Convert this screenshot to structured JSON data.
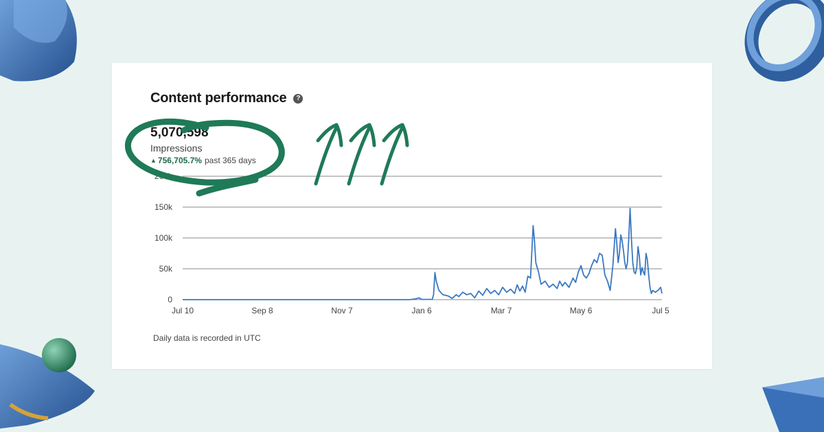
{
  "card": {
    "title": "Content performance",
    "help_icon": "?",
    "metric_value": "5,070,598",
    "metric_label": "Impressions",
    "change_value": "756,705.7%",
    "change_period": "past 365 days",
    "footnote": "Daily data is recorded in UTC"
  },
  "colors": {
    "line": "#3a78c2",
    "annotation": "#1f7a58",
    "change": "#1f6b4a",
    "background": "#e8f3f1"
  },
  "chart_data": {
    "type": "line",
    "y_tick_labels": [
      "0",
      "50k",
      "100k",
      "150k",
      "200k"
    ],
    "y_ticks": [
      0,
      50000,
      100000,
      150000,
      200000
    ],
    "ylim": [
      0,
      200000
    ],
    "x_tick_labels": [
      "Jul 10",
      "Sep 8",
      "Nov 7",
      "Jan 6",
      "Mar 7",
      "May 6",
      "Jul 5"
    ],
    "x_tick_days": [
      0,
      60,
      120,
      180,
      240,
      300,
      360
    ],
    "xlim": [
      0,
      361
    ],
    "grid": true,
    "series": [
      {
        "points": [
          [
            0,
            0
          ],
          [
            120,
            0
          ],
          [
            160,
            0
          ],
          [
            171,
            0
          ],
          [
            176,
            1500
          ],
          [
            178,
            3000
          ],
          [
            180,
            500
          ],
          [
            188,
            500
          ],
          [
            189,
            8000
          ],
          [
            190,
            44000
          ],
          [
            191,
            30000
          ],
          [
            193,
            15000
          ],
          [
            196,
            8000
          ],
          [
            200,
            6000
          ],
          [
            203,
            2000
          ],
          [
            206,
            8000
          ],
          [
            208,
            5000
          ],
          [
            211,
            12000
          ],
          [
            214,
            8000
          ],
          [
            217,
            10000
          ],
          [
            220,
            3000
          ],
          [
            223,
            14000
          ],
          [
            226,
            7000
          ],
          [
            229,
            18000
          ],
          [
            232,
            10000
          ],
          [
            235,
            15000
          ],
          [
            238,
            8000
          ],
          [
            241,
            20000
          ],
          [
            244,
            12000
          ],
          [
            247,
            17000
          ],
          [
            250,
            10000
          ],
          [
            252,
            24000
          ],
          [
            254,
            14000
          ],
          [
            256,
            22000
          ],
          [
            258,
            12000
          ],
          [
            260,
            38000
          ],
          [
            262,
            35000
          ],
          [
            264,
            120000
          ],
          [
            265,
            95000
          ],
          [
            266,
            60000
          ],
          [
            268,
            45000
          ],
          [
            270,
            25000
          ],
          [
            273,
            30000
          ],
          [
            276,
            20000
          ],
          [
            279,
            25000
          ],
          [
            282,
            18000
          ],
          [
            284,
            30000
          ],
          [
            286,
            22000
          ],
          [
            288,
            28000
          ],
          [
            291,
            20000
          ],
          [
            294,
            35000
          ],
          [
            296,
            28000
          ],
          [
            298,
            45000
          ],
          [
            300,
            55000
          ],
          [
            302,
            40000
          ],
          [
            304,
            35000
          ],
          [
            306,
            42000
          ],
          [
            308,
            55000
          ],
          [
            310,
            65000
          ],
          [
            312,
            60000
          ],
          [
            314,
            75000
          ],
          [
            316,
            72000
          ],
          [
            318,
            40000
          ],
          [
            320,
            30000
          ],
          [
            322,
            15000
          ],
          [
            324,
            55000
          ],
          [
            325,
            85000
          ],
          [
            326,
            115000
          ],
          [
            327,
            90000
          ],
          [
            328,
            60000
          ],
          [
            329,
            75000
          ],
          [
            330,
            105000
          ],
          [
            331,
            95000
          ],
          [
            332,
            80000
          ],
          [
            333,
            60000
          ],
          [
            334,
            50000
          ],
          [
            335,
            60000
          ],
          [
            336,
            100000
          ],
          [
            337,
            148000
          ],
          [
            338,
            100000
          ],
          [
            339,
            60000
          ],
          [
            340,
            45000
          ],
          [
            341,
            42000
          ],
          [
            342,
            52000
          ],
          [
            343,
            86000
          ],
          [
            344,
            70000
          ],
          [
            345,
            40000
          ],
          [
            346,
            52000
          ],
          [
            347,
            45000
          ],
          [
            348,
            40000
          ],
          [
            349,
            75000
          ],
          [
            350,
            65000
          ],
          [
            351,
            40000
          ],
          [
            352,
            20000
          ],
          [
            353,
            10000
          ],
          [
            354,
            15000
          ],
          [
            356,
            12000
          ],
          [
            358,
            15000
          ],
          [
            360,
            20000
          ],
          [
            361,
            10000
          ]
        ]
      }
    ]
  }
}
